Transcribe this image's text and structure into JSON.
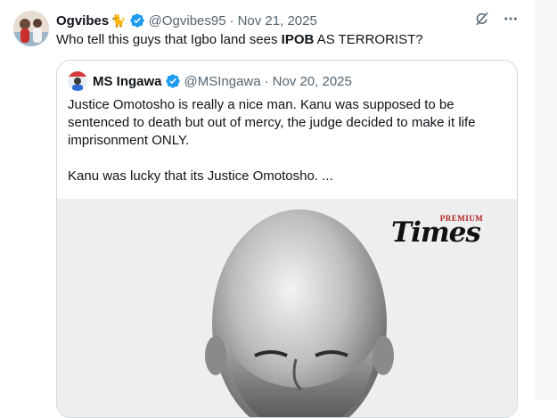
{
  "tweet": {
    "display_name": "Ogvibes",
    "name_emoji": "🐈",
    "handle": "@Ogvibes95",
    "separator": "·",
    "date": "Nov 21, 2025",
    "text_before": "Who tell this guys that Igbo land sees ",
    "text_bold": "IPOB",
    "text_after": " AS TERRORIST?"
  },
  "quote": {
    "display_name": "MS Ingawa",
    "handle": "@MSIngawa",
    "separator": "·",
    "date": "Nov 20, 2025",
    "paragraph_1": "Justice Omotosho is really a nice man. Kanu was supposed to be sentenced to death but out of mercy, the judge decided to make it life imprisonment ONLY.",
    "paragraph_2": "Kanu was lucky that its Justice Omotosho. ...",
    "media": {
      "brand_small": "PREMIUM",
      "brand_main": "Times"
    }
  },
  "icons": {
    "verified": "verified-badge-icon",
    "grok": "grok-icon",
    "more": "more-icon"
  },
  "colors": {
    "verified": "#1d9bf0",
    "secondary_text": "#536471",
    "border": "#cfd9de",
    "brand_red": "#b01d1d"
  }
}
